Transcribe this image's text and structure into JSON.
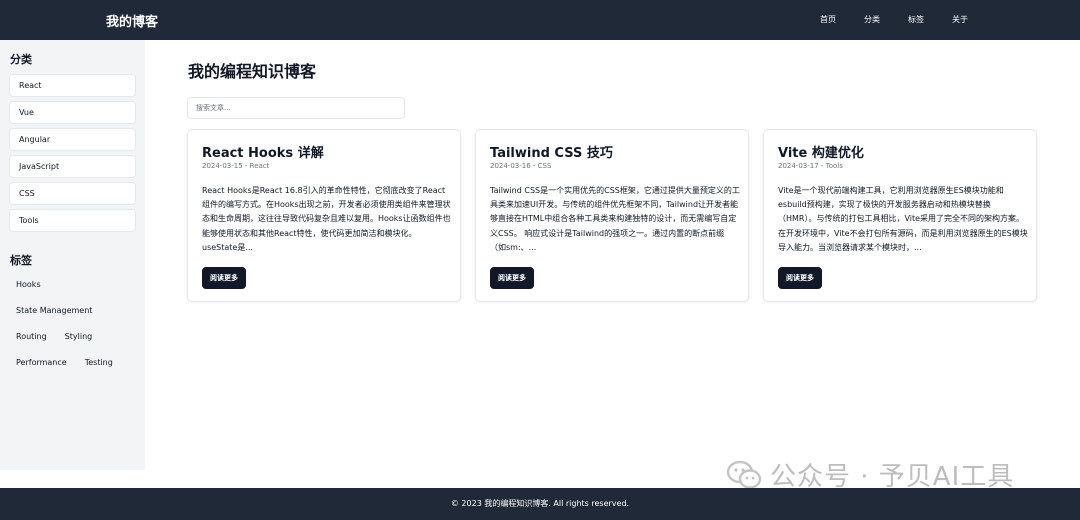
{
  "header": {
    "brand": "我的博客",
    "nav": [
      "首页",
      "分类",
      "标签",
      "关于"
    ]
  },
  "sidebar": {
    "categories_title": "分类",
    "categories": [
      "React",
      "Vue",
      "Angular",
      "JavaScript",
      "CSS",
      "Tools"
    ],
    "tags_title": "标签",
    "tags": [
      "Hooks",
      "State Management",
      "Routing",
      "Styling",
      "Performance",
      "Testing"
    ]
  },
  "main": {
    "title": "我的编程知识博客",
    "search_placeholder": "搜索文章...",
    "posts": [
      {
        "title": "React Hooks 详解",
        "meta": "2024-03-15 - React",
        "excerpt": "React Hooks是React 16.8引入的革命性特性，它彻底改变了React组件的编写方式。在Hooks出现之前，开发者必须使用类组件来管理状态和生命周期，这往往导致代码复杂且难以复用。Hooks让函数组件也能够使用状态和其他React特性，使代码更加简洁和模块化。 useState是...",
        "button": "阅读更多"
      },
      {
        "title": "Tailwind CSS 技巧",
        "meta": "2024-03-16 - CSS",
        "excerpt": "Tailwind CSS是一个实用优先的CSS框架，它通过提供大量预定义的工具类来加速UI开发。与传统的组件优先框架不同，Tailwind让开发者能够直接在HTML中组合各种工具类来构建独特的设计，而无需编写自定义CSS。 响应式设计是Tailwind的强项之一。通过内置的断点前缀（如sm:、...",
        "button": "阅读更多"
      },
      {
        "title": "Vite 构建优化",
        "meta": "2024-03-17 - Tools",
        "excerpt": "Vite是一个现代前端构建工具，它利用浏览器原生ES模块功能和esbuild预构建，实现了极快的开发服务器启动和热模块替换（HMR）。与传统的打包工具相比，Vite采用了完全不同的架构方案。 在开发环境中，Vite不会打包所有源码，而是利用浏览器原生的ES模块导入能力。当浏览器请求某个模块时，...",
        "button": "阅读更多"
      }
    ]
  },
  "footer": {
    "text": "© 2023 我的编程知识博客. All rights reserved."
  },
  "watermark": {
    "text": "公众号 · 予贝AI工具",
    "icon": "wechat-icon"
  }
}
